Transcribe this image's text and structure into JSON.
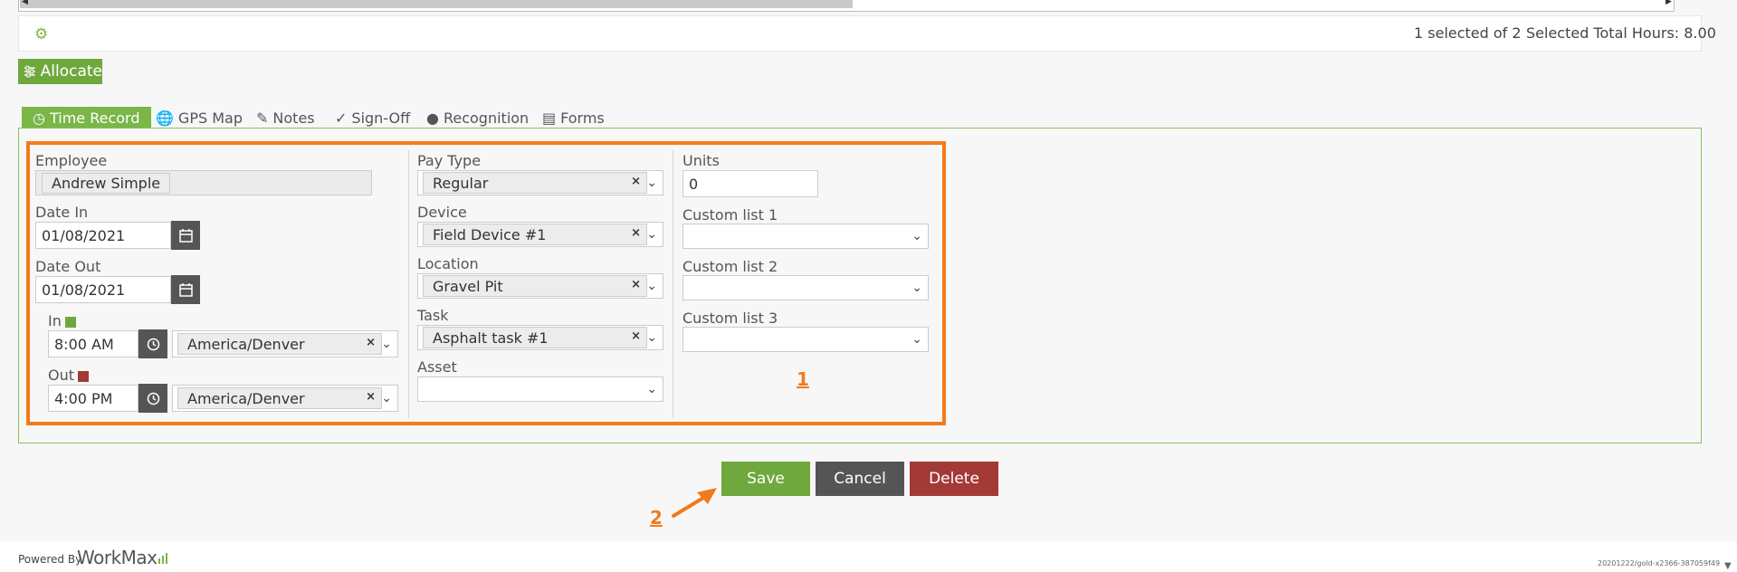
{
  "grid": {
    "selected_text": "1 selected of 2",
    "total_hours_text": "Selected Total Hours: 8.00"
  },
  "allocate_label": "Allocate",
  "tabs": [
    {
      "label": "Time Record",
      "icon": "clock-icon",
      "active": true
    },
    {
      "label": "GPS Map",
      "icon": "globe-icon"
    },
    {
      "label": "Notes",
      "icon": "note-icon"
    },
    {
      "label": "Sign-Off",
      "icon": "check-icon"
    },
    {
      "label": "Recognition",
      "icon": "person-icon"
    },
    {
      "label": "Forms",
      "icon": "form-icon"
    }
  ],
  "form": {
    "employee": {
      "label": "Employee",
      "value": "Andrew Simple"
    },
    "date_in": {
      "label": "Date In",
      "value": "01/08/2021"
    },
    "date_out": {
      "label": "Date Out",
      "value": "01/08/2021"
    },
    "time_in": {
      "label": "In",
      "value": "8:00 AM",
      "timezone": "America/Denver",
      "color": "#6fa83d"
    },
    "time_out": {
      "label": "Out",
      "value": "4:00 PM",
      "timezone": "America/Denver",
      "color": "#a33a36"
    },
    "pay_type": {
      "label": "Pay Type",
      "value": "Regular"
    },
    "device": {
      "label": "Device",
      "value": "Field Device #1"
    },
    "location": {
      "label": "Location",
      "value": "Gravel Pit"
    },
    "task": {
      "label": "Task",
      "value": "Asphalt task #1"
    },
    "asset": {
      "label": "Asset",
      "value": ""
    },
    "units": {
      "label": "Units",
      "value": "0"
    },
    "custom1": {
      "label": "Custom list 1",
      "value": ""
    },
    "custom2": {
      "label": "Custom list 2",
      "value": ""
    },
    "custom3": {
      "label": "Custom list 3",
      "value": ""
    }
  },
  "annotations": {
    "one": "1",
    "two": "2"
  },
  "buttons": {
    "save": "Save",
    "cancel": "Cancel",
    "delete": "Delete"
  },
  "footer": {
    "powered_by": "Powered By",
    "brand": "WorkMax",
    "build": "20201222/gold-x2366-387059f49"
  },
  "colors": {
    "accent_green": "#7ab648",
    "annotation_orange": "#f07b1d",
    "cancel_gray": "#555555",
    "delete_red": "#a33a36"
  }
}
